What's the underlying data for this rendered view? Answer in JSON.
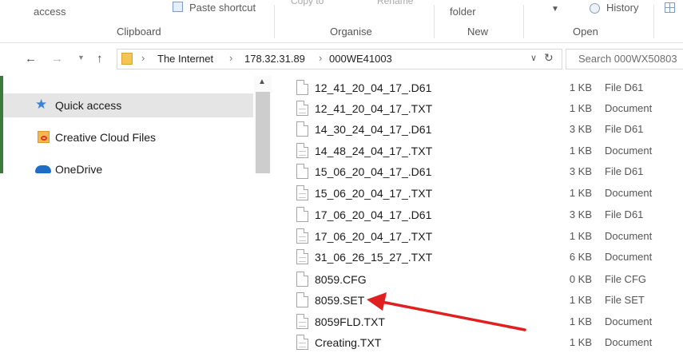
{
  "ribbon": {
    "access_label": "access",
    "paste_shortcut_label": "Paste shortcut",
    "copy_to_label": "Copy to",
    "rename_label": "Rename",
    "new_folder_label": "folder",
    "history_label": "History",
    "groups": {
      "clipboard": "Clipboard",
      "organise": "Organise",
      "new": "New",
      "open": "Open"
    }
  },
  "address": {
    "crumbs": [
      "The Internet",
      "178.32.31.89",
      "000WE41003"
    ],
    "search_placeholder": "Search 000WX50803"
  },
  "nav": {
    "items": [
      {
        "label": "Quick access",
        "icon": "star-icon",
        "selected": true
      },
      {
        "label": "Creative Cloud Files",
        "icon": "creative-cloud-icon",
        "selected": false
      },
      {
        "label": "OneDrive",
        "icon": "onedrive-icon",
        "selected": false
      }
    ]
  },
  "files": [
    {
      "name": "12_41_20_04_17_.D61",
      "size": "1 KB",
      "type": "File D61",
      "icon": "file-icon"
    },
    {
      "name": "12_41_20_04_17_.TXT",
      "size": "1 KB",
      "type": "Document",
      "icon": "text-file-icon"
    },
    {
      "name": "14_30_24_04_17_.D61",
      "size": "3 KB",
      "type": "File D61",
      "icon": "file-icon"
    },
    {
      "name": "14_48_24_04_17_.TXT",
      "size": "1 KB",
      "type": "Document",
      "icon": "text-file-icon"
    },
    {
      "name": "15_06_20_04_17_.D61",
      "size": "3 KB",
      "type": "File D61",
      "icon": "file-icon"
    },
    {
      "name": "15_06_20_04_17_.TXT",
      "size": "1 KB",
      "type": "Document",
      "icon": "text-file-icon"
    },
    {
      "name": "17_06_20_04_17_.D61",
      "size": "3 KB",
      "type": "File D61",
      "icon": "file-icon"
    },
    {
      "name": "17_06_20_04_17_.TXT",
      "size": "1 KB",
      "type": "Document",
      "icon": "text-file-icon"
    },
    {
      "name": "31_06_26_15_27_.TXT",
      "size": "6 KB",
      "type": "Document",
      "icon": "text-file-icon"
    },
    {
      "name": "8059.CFG",
      "size": "0 KB",
      "type": "File CFG",
      "icon": "file-icon"
    },
    {
      "name": "8059.SET",
      "size": "1 KB",
      "type": "File SET",
      "icon": "file-icon"
    },
    {
      "name": "8059FLD.TXT",
      "size": "1 KB",
      "type": "Document",
      "icon": "text-file-icon"
    },
    {
      "name": "Creating.TXT",
      "size": "1 KB",
      "type": "Document",
      "icon": "text-file-icon"
    }
  ],
  "colors": {
    "accent": "#1e70c8",
    "arrow": "#e02020",
    "selection": "#e5e5e5"
  }
}
